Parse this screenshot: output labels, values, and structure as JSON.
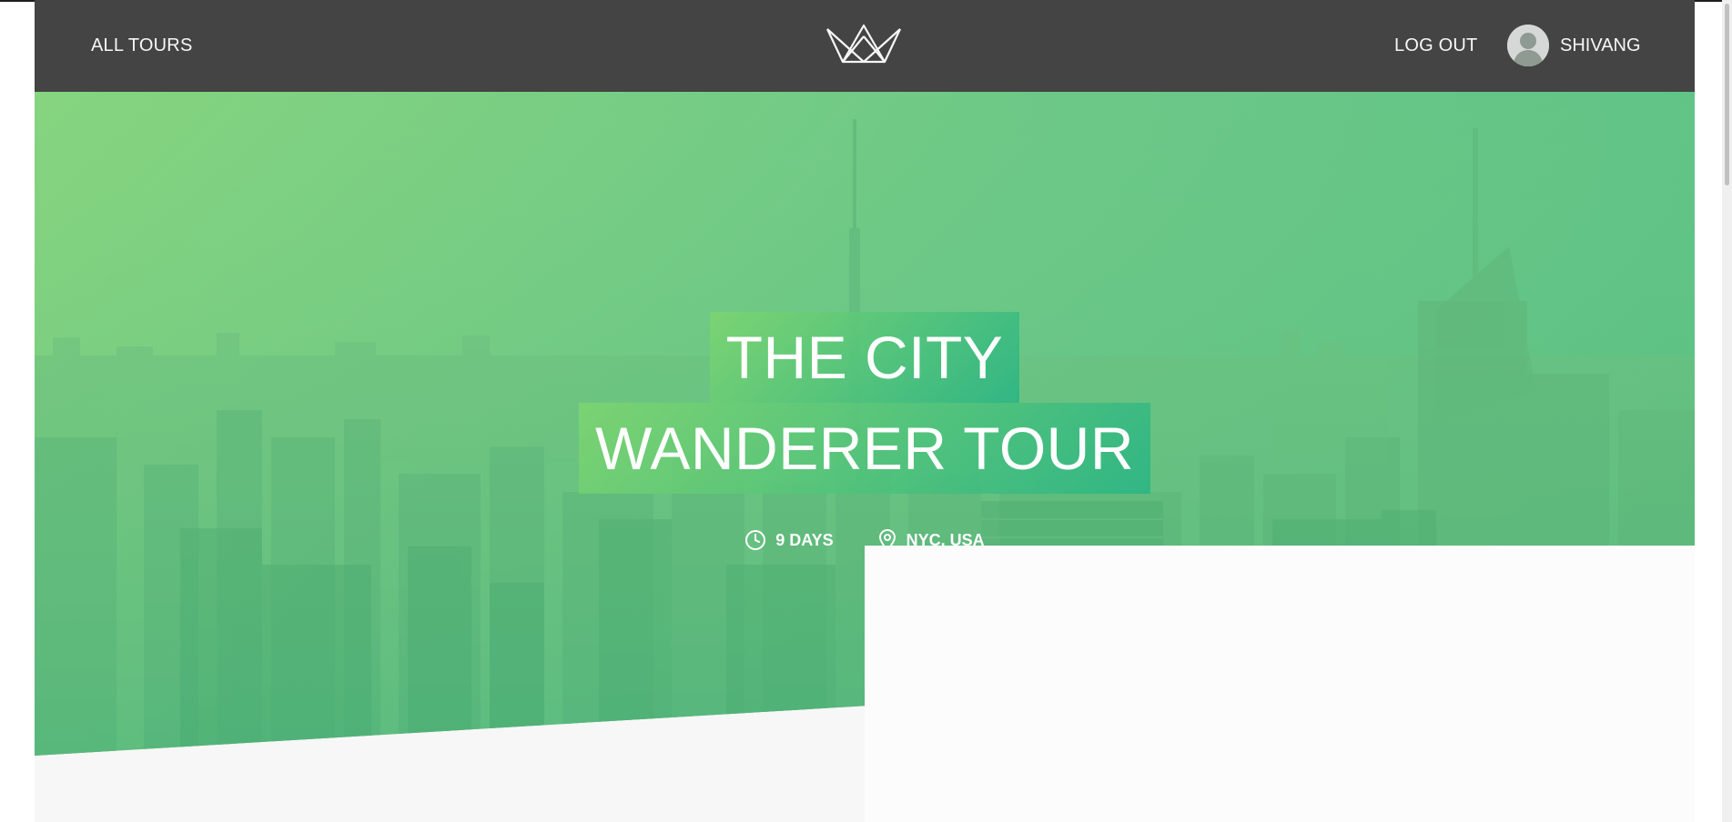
{
  "header": {
    "all_tours_label": "ALL TOURS",
    "logout_label": "LOG OUT",
    "user_name": "SHIVANG",
    "logo_icon": "crown-logo-icon",
    "avatar_icon": "user-avatar-icon"
  },
  "hero": {
    "title_line_1": "THE CITY",
    "title_line_2": "WANDERER TOUR",
    "duration": "9 DAYS",
    "duration_icon": "clock-icon",
    "location": "NYC, USA",
    "location_icon": "map-pin-icon"
  },
  "colors": {
    "header_bg": "#444444",
    "gradient_start": "#7dd56f",
    "gradient_end": "#28b485",
    "page_bg": "#f7f7f7"
  }
}
